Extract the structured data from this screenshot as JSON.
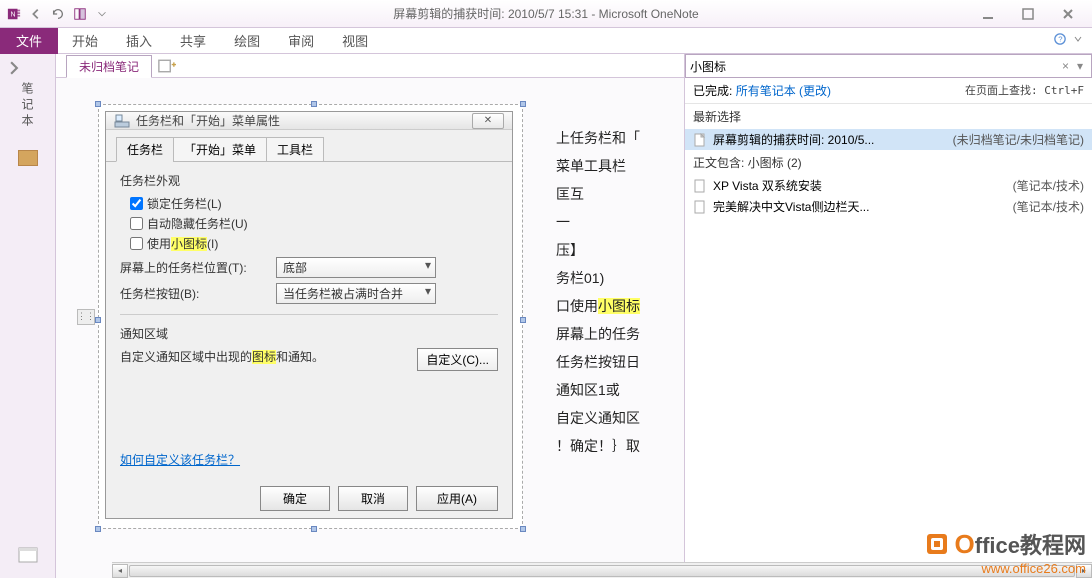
{
  "app": {
    "title": "屏幕剪辑的捕获时间: 2010/5/7 15:31  -  Microsoft OneNote"
  },
  "ribbon": {
    "file": "文件",
    "tabs": [
      "开始",
      "插入",
      "共享",
      "绘图",
      "审阅",
      "视图"
    ]
  },
  "sidebar": {
    "label": "笔记本"
  },
  "pageTab": {
    "active": "未归档笔记"
  },
  "dialog": {
    "title": "任务栏和「开始」菜单属性",
    "tabs": [
      "任务栏",
      "「开始」菜单",
      "工具栏"
    ],
    "groupAppearance": "任务栏外观",
    "cbLock": "锁定任务栏(L)",
    "cbAutohide": "自动隐藏任务栏(U)",
    "cbSmallPre": "使用",
    "cbSmallHl": "小图标",
    "cbSmallPost": "(I)",
    "posLabel": "屏幕上的任务栏位置(T):",
    "posValue": "底部",
    "btnLabel": "任务栏按钮(B):",
    "btnValue": "当任务栏被占满时合并",
    "groupNotify": "通知区域",
    "notifyTextPre": "自定义通知区域中出现的",
    "notifyTextHl": "图标",
    "notifyTextPost": "和通知。",
    "customBtn": "自定义(C)...",
    "helpLink": "如何自定义该任务栏？",
    "ok": "确定",
    "cancel": "取消",
    "apply": "应用(A)"
  },
  "textCol": {
    "l1a": "上任务栏和「",
    "l2": "菜单工具栏",
    "l3": "匡互",
    "l4": "一",
    "l5": "压】",
    "l6": "务栏01)",
    "l7a": "口使用",
    "l7b": "小图标",
    "l8": "屏幕上的任务",
    "l9": "任务栏按钮日",
    "l10": "通知区1或",
    "l11": "自定义通知区",
    "l12": "！确定！｝取"
  },
  "search": {
    "query": "小图标",
    "done": "已完成:",
    "scope": "所有笔记本",
    "change": "(更改)",
    "findOnPage": "在页面上查找: Ctrl+F",
    "recentLabel": "最新选择",
    "recentTitle": "屏幕剪辑的捕获时间: 2010/5...",
    "recentPath": "(未归档笔记/未归档笔记)",
    "bodyLabel": "正文包含: 小图标 (2)",
    "r1title": "XP Vista 双系统安装",
    "r1path": "(笔记本/技术)",
    "r2title": "完美解决中文Vista侧边栏天...",
    "r2path": "(笔记本/技术)"
  },
  "watermark": {
    "brand": "Office教程网",
    "url": "www.office26.com"
  }
}
